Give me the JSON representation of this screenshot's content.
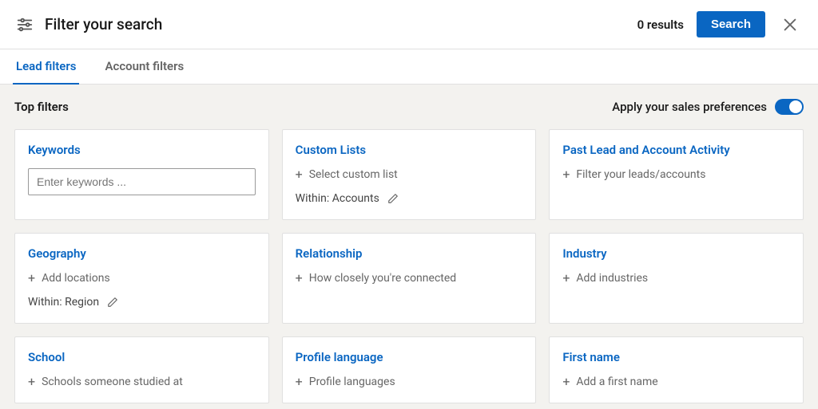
{
  "header": {
    "title": "Filter your search",
    "results_label": "0 results",
    "search_label": "Search"
  },
  "tabs": [
    {
      "label": "Lead filters",
      "active": true
    },
    {
      "label": "Account filters",
      "active": false
    }
  ],
  "section_title": "Top filters",
  "prefs": {
    "label": "Apply your sales preferences",
    "on": true
  },
  "cards": {
    "keywords": {
      "title": "Keywords",
      "placeholder": "Enter keywords ..."
    },
    "custom_lists": {
      "title": "Custom Lists",
      "action": "Select custom list",
      "scope": "Within: Accounts"
    },
    "past_activity": {
      "title": "Past Lead and Account Activity",
      "action": "Filter your leads/accounts"
    },
    "geography": {
      "title": "Geography",
      "action": "Add locations",
      "scope": "Within: Region"
    },
    "relationship": {
      "title": "Relationship",
      "action": "How closely you're connected"
    },
    "industry": {
      "title": "Industry",
      "action": "Add industries"
    },
    "school": {
      "title": "School",
      "action": "Schools someone studied at"
    },
    "profile_language": {
      "title": "Profile language",
      "action": "Profile languages"
    },
    "first_name": {
      "title": "First name",
      "action": "Add a first name"
    }
  }
}
